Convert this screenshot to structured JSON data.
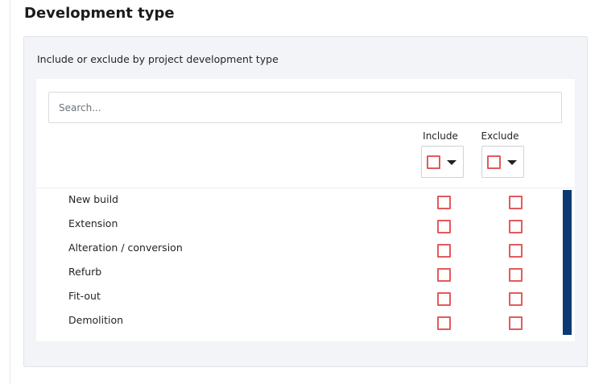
{
  "page": {
    "title": "Development type"
  },
  "panel": {
    "label": "Include or exclude by project development type"
  },
  "search": {
    "placeholder": "Search..."
  },
  "columns": {
    "include": "Include",
    "exclude": "Exclude"
  },
  "rows": [
    {
      "label": "New build",
      "include": false,
      "exclude": false
    },
    {
      "label": "Extension",
      "include": false,
      "exclude": false
    },
    {
      "label": "Alteration / conversion",
      "include": false,
      "exclude": false
    },
    {
      "label": "Refurb",
      "include": false,
      "exclude": false
    },
    {
      "label": "Fit-out",
      "include": false,
      "exclude": false
    },
    {
      "label": "Demolition",
      "include": false,
      "exclude": false
    }
  ],
  "colors": {
    "checkbox_border": "#e35a5a",
    "scrollbar": "#0b3a73",
    "panel_bg": "#f3f4f7"
  }
}
